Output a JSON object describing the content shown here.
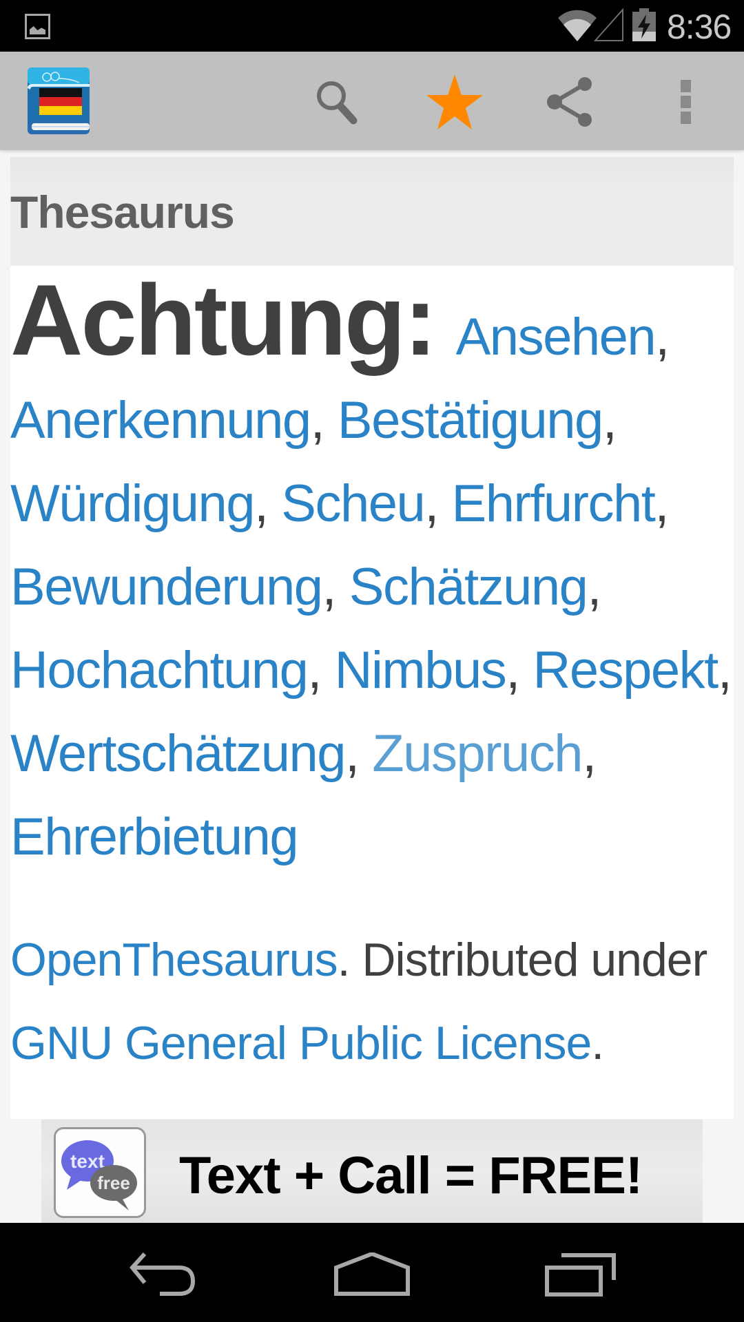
{
  "status_bar": {
    "time": "8:36",
    "icons": [
      "gallery-notification-icon",
      "wifi-icon",
      "cell-signal-icon",
      "battery-charging-icon"
    ]
  },
  "toolbar": {
    "app_icon": "german-thesaurus-book-icon",
    "actions": [
      {
        "name": "search",
        "icon": "search-icon"
      },
      {
        "name": "favorite",
        "icon": "star-icon",
        "active": true,
        "color": "#ff8800"
      },
      {
        "name": "share",
        "icon": "share-icon"
      },
      {
        "name": "more",
        "icon": "overflow-menu-icon"
      }
    ]
  },
  "card": {
    "title": "Thesaurus",
    "entry": {
      "word": "Achtung:",
      "synonyms": [
        {
          "text": "Ansehen"
        },
        {
          "text": "Anerkennung"
        },
        {
          "text": "Bestätigung"
        },
        {
          "text": "Würdigung"
        },
        {
          "text": "Scheu"
        },
        {
          "text": "Ehrfurcht"
        },
        {
          "text": "Bewunderung"
        },
        {
          "text": "Schätzung"
        },
        {
          "text": "Hochachtung"
        },
        {
          "text": "Nimbus"
        },
        {
          "text": "Respekt"
        },
        {
          "text": "Wertschätzung"
        },
        {
          "text": "Zuspruch",
          "visited": true
        },
        {
          "text": "Ehrerbietung"
        }
      ],
      "separator": ", "
    },
    "attribution": {
      "source_link": "OpenThesaurus",
      "middle_text": ". Distributed under ",
      "license_link": "GNU General Public License",
      "end_text": "."
    }
  },
  "ad": {
    "icon_text_top": "text",
    "icon_text_bottom": "free",
    "headline": "Text + Call = FREE!"
  },
  "nav_bar": {
    "buttons": [
      "back",
      "home",
      "recents"
    ]
  },
  "colors": {
    "link": "#2a83c6",
    "link_visited": "#5a9fd4",
    "accent_star": "#ff8800",
    "toolbar_bg": "#c0c0c0",
    "header_bg": "#ececec",
    "text": "#404040"
  }
}
